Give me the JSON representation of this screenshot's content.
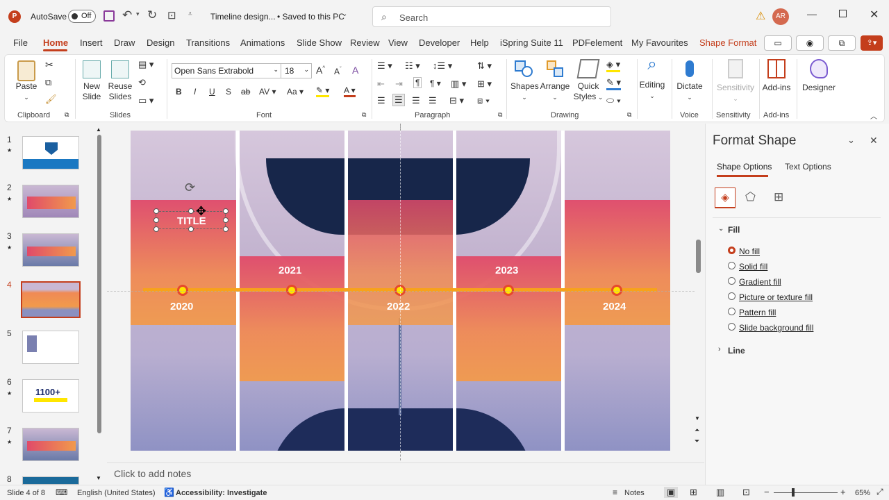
{
  "titlebar": {
    "autosave_label": "AutoSave",
    "autosave_state": "Off",
    "doc_title": "Timeline design...",
    "save_status": "• Saved to this PC",
    "search_placeholder": "Search",
    "avatar_initials": "AR"
  },
  "tabs": [
    "File",
    "Home",
    "Insert",
    "Draw",
    "Design",
    "Transitions",
    "Animations",
    "Slide Show",
    "Review",
    "View",
    "Developer",
    "Help",
    "iSpring Suite 11",
    "PDFelement",
    "My Favourites",
    "Shape Format"
  ],
  "ribbon": {
    "paste": "Paste",
    "new_slide": "New",
    "new_slide2": "Slide",
    "reuse": "Reuse",
    "reuse2": "Slides",
    "font_name": "Open Sans Extrabold",
    "font_size": "18",
    "shapes": "Shapes",
    "arrange": "Arrange",
    "quick": "Quick",
    "styles": "Styles",
    "editing": "Editing",
    "dictate": "Dictate",
    "sensitivity": "Sensitivity",
    "addins": "Add-ins",
    "designer": "Designer",
    "groups": {
      "clipboard": "Clipboard",
      "slides": "Slides",
      "font": "Font",
      "paragraph": "Paragraph",
      "drawing": "Drawing",
      "voice": "Voice",
      "sensitivity": "Sensitivity",
      "addins": "Add-ins"
    }
  },
  "thumbnails": [
    "1",
    "2",
    "3",
    "4",
    "5",
    "6",
    "7",
    "8"
  ],
  "thumb6_text": "1100+",
  "slide": {
    "title_text": "TITLE",
    "years": [
      "2020",
      "2021",
      "2022",
      "2023",
      "2024"
    ]
  },
  "notes_placeholder": "Click to add notes",
  "format_pane": {
    "title": "Format Shape",
    "tab_shape": "Shape Options",
    "tab_text": "Text Options",
    "fill_header": "Fill",
    "line_header": "Line",
    "options": [
      "No fill",
      "Solid fill",
      "Gradient fill",
      "Picture or texture fill",
      "Pattern fill",
      "Slide background fill"
    ],
    "selected": "No fill"
  },
  "status": {
    "slide_info": "Slide 4 of 8",
    "language": "English (United States)",
    "accessibility": "Accessibility: Investigate",
    "notes": "Notes",
    "zoom": "65%"
  },
  "colors": {
    "accent": "#c43e1c",
    "timeline": "#f7a21b",
    "band_top": "#e04a6a",
    "band_bottom": "#f19a4c"
  }
}
